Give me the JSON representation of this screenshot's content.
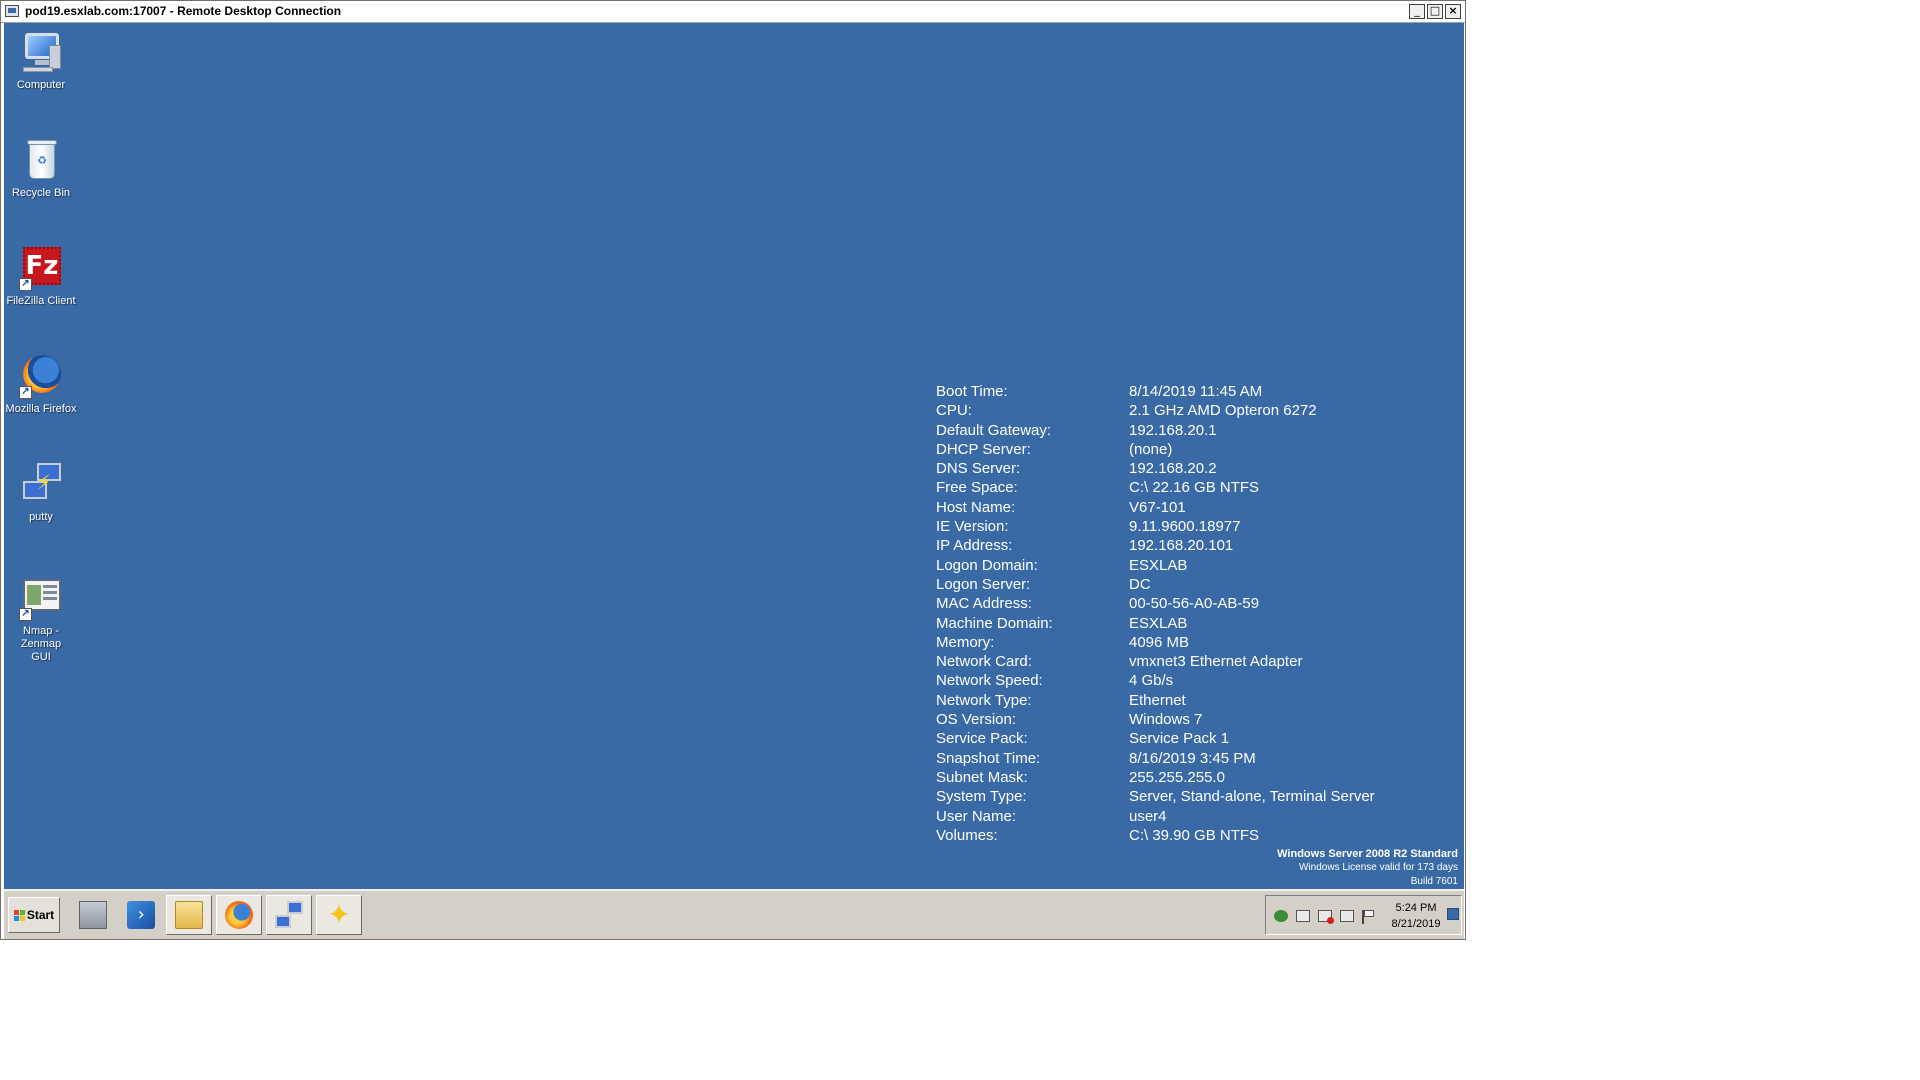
{
  "window": {
    "title": "pod19.esxlab.com:17007 - Remote Desktop Connection",
    "minimize_label": "_",
    "maximize_label": "□",
    "close_label": "×"
  },
  "desktop": {
    "background_color": "#3a6aa6",
    "icons": [
      {
        "label": "Computer",
        "icon": "computer-icon"
      },
      {
        "label": "Recycle Bin",
        "icon": "recycle-bin-icon"
      },
      {
        "label": "FileZilla Client",
        "icon": "filezilla-icon"
      },
      {
        "label": "Mozilla Firefox",
        "icon": "firefox-icon"
      },
      {
        "label": "putty",
        "icon": "putty-icon"
      },
      {
        "label": "Nmap - Zenmap GUI",
        "icon": "nmap-icon"
      }
    ],
    "bginfo": [
      {
        "label": "Boot Time:",
        "value": "8/14/2019 11:45 AM"
      },
      {
        "label": "CPU:",
        "value": "2.1 GHz AMD Opteron 6272"
      },
      {
        "label": "Default Gateway:",
        "value": "192.168.20.1"
      },
      {
        "label": "DHCP Server:",
        "value": "(none)"
      },
      {
        "label": "DNS Server:",
        "value": "192.168.20.2"
      },
      {
        "label": "Free Space:",
        "value": "C:\\ 22.16 GB NTFS"
      },
      {
        "label": "Host Name:",
        "value": "V67-101"
      },
      {
        "label": "IE Version:",
        "value": "9.11.9600.18977"
      },
      {
        "label": "IP Address:",
        "value": "192.168.20.101"
      },
      {
        "label": "Logon Domain:",
        "value": "ESXLAB"
      },
      {
        "label": "Logon Server:",
        "value": "DC"
      },
      {
        "label": "MAC Address:",
        "value": "00-50-56-A0-AB-59"
      },
      {
        "label": "Machine Domain:",
        "value": "ESXLAB"
      },
      {
        "label": "Memory:",
        "value": "4096 MB"
      },
      {
        "label": "Network Card:",
        "value": "vmxnet3 Ethernet Adapter"
      },
      {
        "label": "Network Speed:",
        "value": "4 Gb/s"
      },
      {
        "label": "Network Type:",
        "value": "Ethernet"
      },
      {
        "label": "OS Version:",
        "value": "Windows 7"
      },
      {
        "label": "Service Pack:",
        "value": "Service Pack 1"
      },
      {
        "label": "Snapshot Time:",
        "value": "8/16/2019 3:45 PM"
      },
      {
        "label": "Subnet Mask:",
        "value": "255.255.255.0"
      },
      {
        "label": "System Type:",
        "value": "Server, Stand-alone, Terminal Server"
      },
      {
        "label": "User Name:",
        "value": "user4"
      },
      {
        "label": "Volumes:",
        "value": "C:\\ 39.90 GB NTFS"
      }
    ],
    "server_info": {
      "os": "Windows Server 2008 R2 Standard",
      "license": "Windows License valid for 173 days",
      "build": "Build 7601"
    }
  },
  "taskbar": {
    "start_label": "Start",
    "pinned": [
      {
        "icon": "server-manager-icon"
      },
      {
        "icon": "powershell-icon"
      },
      {
        "icon": "explorer-folder-icon"
      },
      {
        "icon": "firefox-icon"
      },
      {
        "icon": "putty-icon"
      },
      {
        "icon": "sticky-notes-icon"
      }
    ],
    "tray": {
      "icons": [
        "network-icon",
        "action-center-icon",
        "volume-muted-icon",
        "display-icon",
        "flag-icon"
      ],
      "time": "5:24 PM",
      "date": "8/21/2019"
    }
  }
}
